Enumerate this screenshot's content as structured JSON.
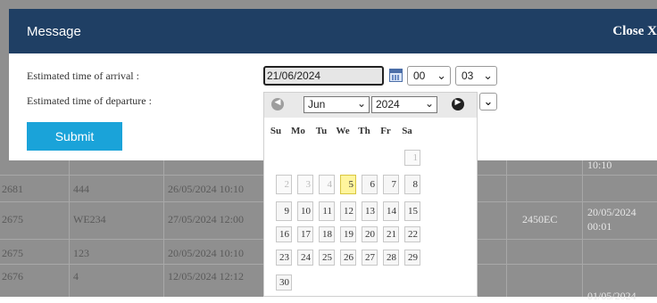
{
  "modal": {
    "title": "Message",
    "close_label": "Close X",
    "arrival_label": "Estimated time of arrival :",
    "departure_label": "Estimated time of departure :",
    "date_value": "21/06/2024",
    "hour_value": "00",
    "minute_value": "03",
    "submit_label": "Submit"
  },
  "datepicker": {
    "month": "Jun",
    "year": "2024",
    "weekdays": [
      "Su",
      "Mo",
      "Tu",
      "We",
      "Th",
      "Fr",
      "Sa"
    ],
    "rows": [
      [
        "",
        "",
        "",
        "",
        "",
        "",
        "1"
      ],
      [
        "2",
        "3",
        "4",
        "5",
        "6",
        "7",
        "8"
      ],
      [
        "9",
        "10",
        "11",
        "12",
        "13",
        "14",
        "15"
      ],
      [
        "16",
        "17",
        "18",
        "19",
        "20",
        "21",
        "22"
      ],
      [
        "23",
        "24",
        "25",
        "26",
        "27",
        "28",
        "29"
      ],
      [
        "30",
        "",
        "",
        "",
        "",
        "",
        ""
      ]
    ],
    "highlighted_day": "5"
  },
  "table": {
    "rows": [
      {
        "id": "2681",
        "code": "444",
        "date": "26/05/2024 10:10",
        "extra": "",
        "time": ""
      },
      {
        "id": "2675",
        "code": "WE234",
        "date": "27/05/2024 12:00",
        "extra": "2450EC",
        "time": "20/05/2024 00:01"
      },
      {
        "id": "2675",
        "code": "123",
        "date": "20/05/2024 10:10",
        "extra": "",
        "time": ""
      },
      {
        "id": "2676",
        "code": "4",
        "date": "12/05/2024 12:12",
        "extra": "",
        "time": ""
      }
    ],
    "partial_top_time": "10:10",
    "partial_bottom_time": "01/05/2024"
  }
}
